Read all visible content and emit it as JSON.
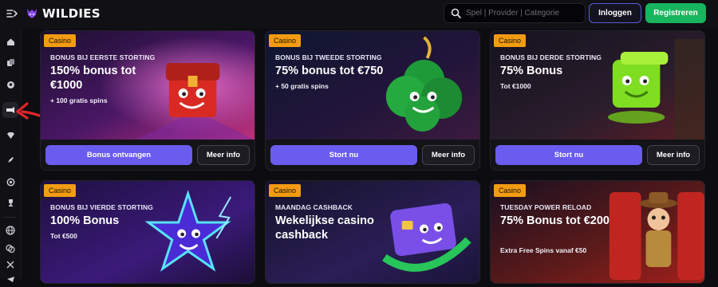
{
  "header": {
    "brand": "WILDIES",
    "search_placeholder": "Spel | Provider | Categorie",
    "login_label": "Inloggen",
    "register_label": "Registreren"
  },
  "sidebar": {
    "items": [
      {
        "icon": "collapse-icon"
      },
      {
        "icon": "home-icon"
      },
      {
        "icon": "cards-icon"
      },
      {
        "icon": "sports-ball-icon"
      },
      {
        "icon": "promotions-icon"
      },
      {
        "icon": "gem-icon"
      },
      {
        "icon": "rocket-icon"
      },
      {
        "icon": "target-icon"
      },
      {
        "icon": "trophy-icon"
      },
      {
        "icon": "globe-icon"
      },
      {
        "icon": "chat-icon"
      },
      {
        "icon": "x-social-icon"
      },
      {
        "icon": "telegram-icon"
      }
    ]
  },
  "colors": {
    "primary_button": "#6b5cf0",
    "register_button": "#17b55d",
    "tag": "#f39c12",
    "annotation_arrow": "#e0252b"
  },
  "promotions": [
    {
      "tag": "Casino",
      "subtitle": "BONUS BIJ EERSTE STORTING",
      "title": "150% bonus tot €1000",
      "extra": "+ 100 gratis spins",
      "primary": "Bonus ontvangen",
      "secondary": "Meer info"
    },
    {
      "tag": "Casino",
      "subtitle": "BONUS BIJ TWEEDE STORTING",
      "title": "75% bonus tot €750",
      "extra": "+ 50 gratis spins",
      "primary": "Stort nu",
      "secondary": "Meer info"
    },
    {
      "tag": "Casino",
      "subtitle": "BONUS BIJ DERDE STORTING",
      "title": "75% Bonus",
      "extra": "Tot €1000",
      "primary": "Stort nu",
      "secondary": "Meer info"
    },
    {
      "tag": "Casino",
      "subtitle": "BONUS BIJ VIERDE STORTING",
      "title": "100% Bonus",
      "extra": "Tot €500"
    },
    {
      "tag": "Casino",
      "subtitle": "MAANDAG CASHBACK",
      "title": "Wekelijkse casino cashback",
      "extra": ""
    },
    {
      "tag": "Casino",
      "subtitle": "TUESDAY POWER RELOAD",
      "title": "75% Bonus tot €200",
      "extra": "Extra Free Spins vanaf €50"
    }
  ]
}
